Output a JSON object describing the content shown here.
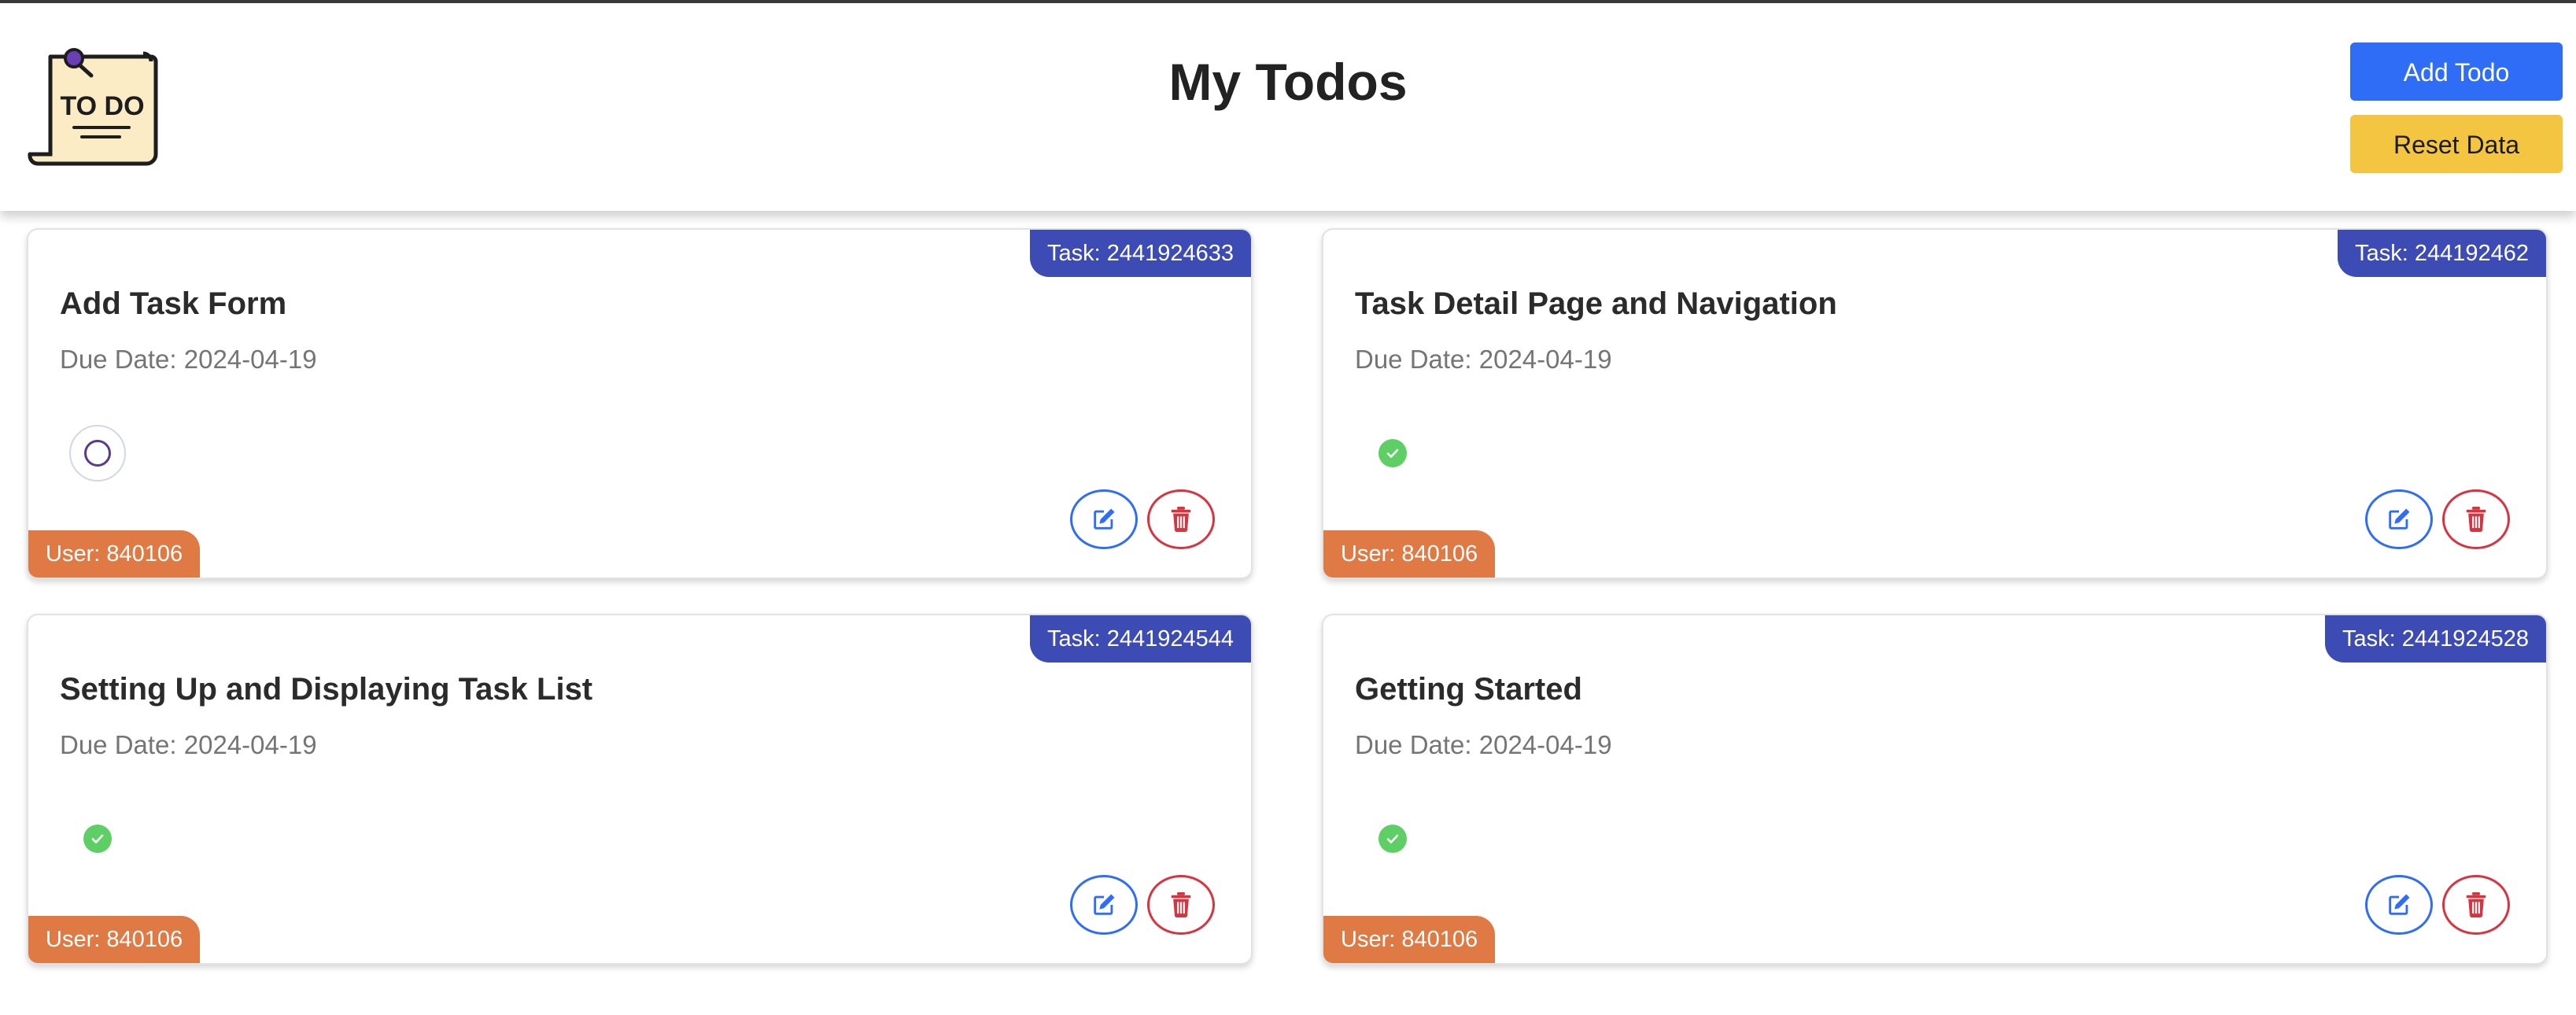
{
  "header": {
    "title": "My Todos",
    "logo_text": "TO DO",
    "add_label": "Add Todo",
    "reset_label": "Reset Data"
  },
  "colors": {
    "primary": "#2f6df6",
    "warning": "#f4c541",
    "task_badge": "#3d4cb4",
    "user_badge": "#e07a45",
    "done": "#5ecf65",
    "danger": "#d8343f"
  },
  "todos": [
    {
      "title": "Add Task Form",
      "due": "Due Date: 2024-04-19",
      "task_label": "Task: 2441924633",
      "user_label": "User: 840106",
      "completed": false,
      "status_icon": "empty-circle-icon"
    },
    {
      "title": "Task Detail Page and Navigation",
      "due": "Due Date: 2024-04-19",
      "task_label": "Task: 244192462",
      "user_label": "User: 840106",
      "completed": true,
      "status_icon": "check-circle-icon"
    },
    {
      "title": "Setting Up and Displaying Task List",
      "due": "Due Date: 2024-04-19",
      "task_label": "Task: 2441924544",
      "user_label": "User: 840106",
      "completed": true,
      "status_icon": "check-circle-icon"
    },
    {
      "title": "Getting Started",
      "due": "Due Date: 2024-04-19",
      "task_label": "Task: 2441924528",
      "user_label": "User: 840106",
      "completed": true,
      "status_icon": "check-circle-icon"
    }
  ]
}
